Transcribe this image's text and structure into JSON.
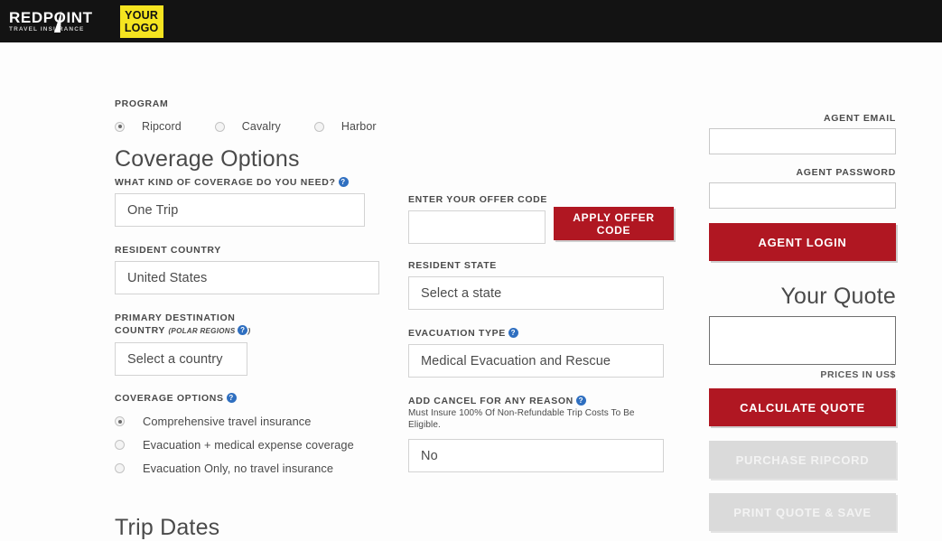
{
  "header": {
    "brand_name": "REDPOINT",
    "brand_sub": "TRAVEL INSURANCE",
    "logo_line1": "YOUR",
    "logo_line2": "LOGO",
    "bg_color": "#131313",
    "logo_bg_color": "#f5e420"
  },
  "program": {
    "label": "PROGRAM",
    "options": [
      {
        "label": "Ripcord",
        "selected": true
      },
      {
        "label": "Cavalry",
        "selected": false
      },
      {
        "label": "Harbor",
        "selected": false
      }
    ]
  },
  "coverage": {
    "heading": "Coverage Options",
    "kind_label": "WHAT KIND OF COVERAGE DO YOU NEED?",
    "kind_value": "One Trip",
    "resident_country_label": "RESIDENT COUNTRY",
    "resident_country_value": "United States",
    "destination_label_line1": "PRIMARY DESTINATION",
    "destination_label_line2": "COUNTRY",
    "destination_note": "(POLAR REGIONS",
    "destination_note_close": ")",
    "destination_value": "Select a country",
    "options_label": "COVERAGE OPTIONS",
    "options": [
      {
        "label": "Comprehensive travel insurance",
        "selected": true
      },
      {
        "label": "Evacuation + medical expense coverage",
        "selected": false
      },
      {
        "label": "Evacuation Only, no travel insurance",
        "selected": false
      }
    ]
  },
  "middle": {
    "offer_label": "ENTER YOUR OFFER CODE",
    "offer_value": "",
    "offer_placeholder": "",
    "apply_button": "APPLY OFFER CODE",
    "resident_state_label": "RESIDENT STATE",
    "resident_state_value": "Select a state",
    "evacuation_label": "EVACUATION TYPE",
    "evacuation_value": "Medical Evacuation and Rescue",
    "cfar_label": "ADD CANCEL FOR ANY REASON",
    "cfar_note": "Must Insure 100% Of Non-Refundable Trip Costs To Be Eligible.",
    "cfar_value": "No"
  },
  "agent": {
    "email_label": "AGENT EMAIL",
    "email_value": "",
    "password_label": "AGENT PASSWORD",
    "password_value": "",
    "login_button": "AGENT LOGIN"
  },
  "quote": {
    "heading": "Your Quote",
    "amount": "",
    "prices_note": "PRICES IN US$",
    "calculate_button": "CALCULATE QUOTE",
    "purchase_button": "PURCHASE RIPCORD",
    "print_button": "PRINT QUOTE & SAVE"
  },
  "trip_dates": {
    "heading": "Trip Dates"
  },
  "icons": {
    "help": "?"
  },
  "colors": {
    "accent_red": "#b01722",
    "help_blue": "#2f6fc0",
    "disabled_gray": "#dadada"
  }
}
